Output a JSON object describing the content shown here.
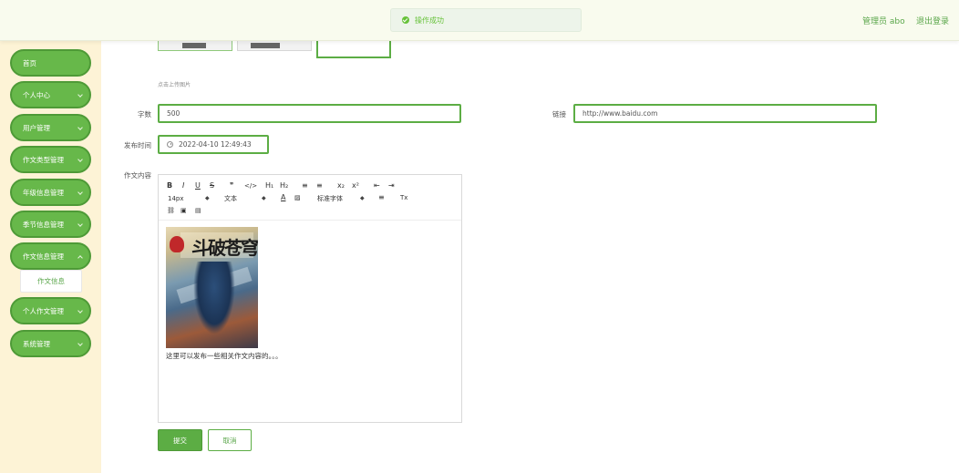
{
  "header": {
    "toast": "操作成功",
    "user": "管理员 abo",
    "logout": "退出登录"
  },
  "sidebar": {
    "items": [
      {
        "label": "首页"
      },
      {
        "label": "个人中心"
      },
      {
        "label": "用户管理"
      },
      {
        "label": "作文类型管理"
      },
      {
        "label": "年级信息管理"
      },
      {
        "label": "季节信息管理"
      },
      {
        "label": "作文信息管理"
      },
      {
        "label": "个人作文管理"
      },
      {
        "label": "系统管理"
      }
    ],
    "submenu": "作文信息"
  },
  "form": {
    "upload_hint": "点击上传图片",
    "wordcount_label": "字数",
    "wordcount_value": "500",
    "link_label": "链接",
    "link_value": "http://www.baidu.com",
    "time_label": "发布时间",
    "time_value": "2022-04-10 12:49:43",
    "content_label": "作文内容"
  },
  "editor": {
    "toolbar": {
      "bold": "B",
      "italic": "I",
      "underline": "U",
      "strike": "S",
      "quote": "❞",
      "code": "</>",
      "h1": "H₁",
      "h2": "H₂",
      "ordered_list": "≡",
      "bullet_list": "≡",
      "subscript": "x₂",
      "superscript": "x²",
      "outdent": "⇤",
      "indent": "⇥",
      "font_size": "14px",
      "text_style": "文本",
      "font_color": "A",
      "bg_color": "▨",
      "font_family": "标准字体",
      "align": "≡",
      "clear": "Tx",
      "link": "⛓",
      "image": "▣",
      "video": "▤"
    },
    "cover_title": "斗破苍穹",
    "caption": "这里可以发布一些相关作文内容的。。。"
  },
  "buttons": {
    "submit": "提交",
    "cancel": "取消"
  },
  "colors": {
    "accent": "#5cad44",
    "sidebar_bg": "#fdf3d6",
    "header_bg": "#f9fbee"
  }
}
